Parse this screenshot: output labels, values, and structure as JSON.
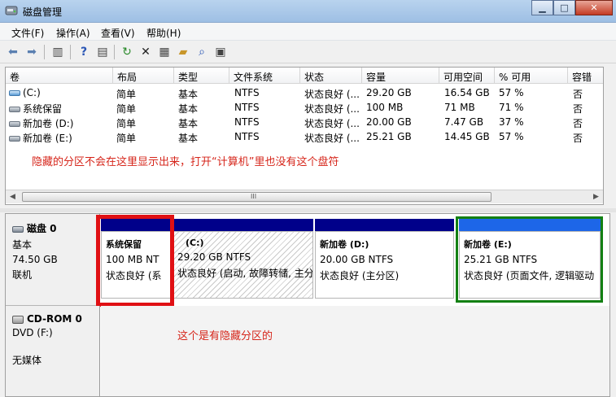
{
  "window": {
    "title": "磁盘管理"
  },
  "menu": {
    "items": [
      "文件(F)",
      "操作(A)",
      "查看(V)",
      "帮助(H)"
    ]
  },
  "volume_list": {
    "columns": [
      "卷",
      "布局",
      "类型",
      "文件系统",
      "状态",
      "容量",
      "可用空间",
      "% 可用",
      "容错"
    ],
    "rows": [
      {
        "volume": "(C:)",
        "layout": "简单",
        "type": "基本",
        "fs": "NTFS",
        "status": "状态良好 (...",
        "capacity": "29.20 GB",
        "free": "16.54 GB",
        "pct": "57 %",
        "fault": "否"
      },
      {
        "volume": "系统保留",
        "layout": "简单",
        "type": "基本",
        "fs": "NTFS",
        "status": "状态良好 (...",
        "capacity": "100 MB",
        "free": "71 MB",
        "pct": "71 %",
        "fault": "否"
      },
      {
        "volume": "新加卷 (D:)",
        "layout": "简单",
        "type": "基本",
        "fs": "NTFS",
        "status": "状态良好 (...",
        "capacity": "20.00 GB",
        "free": "7.47 GB",
        "pct": "37 %",
        "fault": "否"
      },
      {
        "volume": "新加卷 (E:)",
        "layout": "简单",
        "type": "基本",
        "fs": "NTFS",
        "status": "状态良好 (...",
        "capacity": "25.21 GB",
        "free": "14.45 GB",
        "pct": "57 %",
        "fault": "否"
      }
    ],
    "annotation": "隐藏的分区不会在这里显示出来，打开“计算机”里也没有这个盘符",
    "scroll_grip": "III"
  },
  "disk0": {
    "name": "磁盘 0",
    "type": "基本",
    "size": "74.50 GB",
    "status": "联机",
    "partitions": [
      {
        "name": "系统保留",
        "size": "100 MB NT",
        "status": "状态良好 (系"
      },
      {
        "name": "(C:)",
        "size": "29.20 GB NTFS",
        "status": "状态良好 (启动, 故障转储, 主分"
      },
      {
        "name": "新加卷  (D:)",
        "size": "20.00 GB NTFS",
        "status": "状态良好 (主分区)"
      },
      {
        "name": "新加卷  (E:)",
        "size": "25.21 GB NTFS",
        "status": "状态良好 (页面文件, 逻辑驱动"
      }
    ]
  },
  "cdrom0": {
    "name": "CD-ROM 0",
    "type": "DVD (F:)",
    "media": "无媒体",
    "annotation": "这个是有隐藏分区的"
  },
  "colors": {
    "primary_partition": "#00008a",
    "logical_partition": "#1d66e8",
    "annotation": "#d6261b",
    "highlight_red": "#e01014",
    "highlight_green": "#138013"
  }
}
